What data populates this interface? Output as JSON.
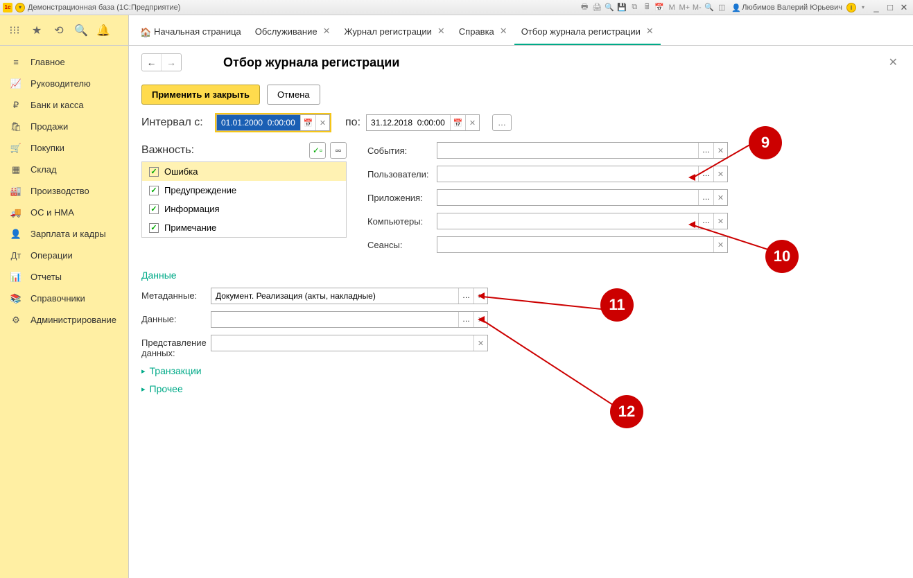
{
  "titlebar": {
    "app_title": "Демонстрационная база  (1С:Предприятие)",
    "toolbar_m": "M",
    "toolbar_mplus": "M+",
    "toolbar_mminus": "M-",
    "user_name": "Любимов Валерий Юрьевич",
    "info": "i"
  },
  "toplevel_tabs": [
    {
      "label": "Начальная страница",
      "home": true,
      "closable": false
    },
    {
      "label": "Обслуживание",
      "closable": true
    },
    {
      "label": "Журнал регистрации",
      "closable": true
    },
    {
      "label": "Справка",
      "closable": true
    },
    {
      "label": "Отбор журнала регистрации",
      "closable": true,
      "active": true
    }
  ],
  "sidebar": [
    {
      "icon": "≡",
      "label": "Главное"
    },
    {
      "icon": "📈",
      "label": "Руководителю"
    },
    {
      "icon": "₽",
      "label": "Банк и касса"
    },
    {
      "icon": "🛍",
      "label": "Продажи"
    },
    {
      "icon": "🛒",
      "label": "Покупки"
    },
    {
      "icon": "▦",
      "label": "Склад"
    },
    {
      "icon": "🏭",
      "label": "Производство"
    },
    {
      "icon": "🚚",
      "label": "ОС и НМА"
    },
    {
      "icon": "👤",
      "label": "Зарплата и кадры"
    },
    {
      "icon": "Дт",
      "label": "Операции"
    },
    {
      "icon": "📊",
      "label": "Отчеты"
    },
    {
      "icon": "📚",
      "label": "Справочники"
    },
    {
      "icon": "⚙",
      "label": "Администрирование"
    }
  ],
  "page": {
    "title": "Отбор журнала регистрации",
    "apply_close": "Применить и закрыть",
    "cancel": "Отмена",
    "interval_from_label": "Интервал с:",
    "interval_from_value": "01.01.2000  0:00:00",
    "interval_to_label": "по:",
    "interval_to_value": "31.12.2018  0:00:00",
    "importance_label": "Важность:",
    "importance_items": [
      {
        "label": "Ошибка",
        "checked": true,
        "selected": true
      },
      {
        "label": "Предупреждение",
        "checked": true
      },
      {
        "label": "Информация",
        "checked": true
      },
      {
        "label": "Примечание",
        "checked": true
      }
    ],
    "filters": [
      {
        "label": "События:",
        "value": ""
      },
      {
        "label": "Пользователи:",
        "value": ""
      },
      {
        "label": "Приложения:",
        "value": ""
      },
      {
        "label": "Компьютеры:",
        "value": ""
      },
      {
        "label": "Сеансы:",
        "value": "",
        "no_dots": true
      }
    ],
    "data_section": "Данные",
    "metadata_label": "Метаданные:",
    "metadata_value": "Документ. Реализация (акты, накладные)",
    "data_label": "Данные:",
    "data_value": "",
    "repr_label": "Представление данных:",
    "repr_value": "",
    "transactions": "Транзакции",
    "other": "Прочее"
  },
  "callouts": {
    "c9": "9",
    "c10": "10",
    "c11": "11",
    "c12": "12"
  }
}
